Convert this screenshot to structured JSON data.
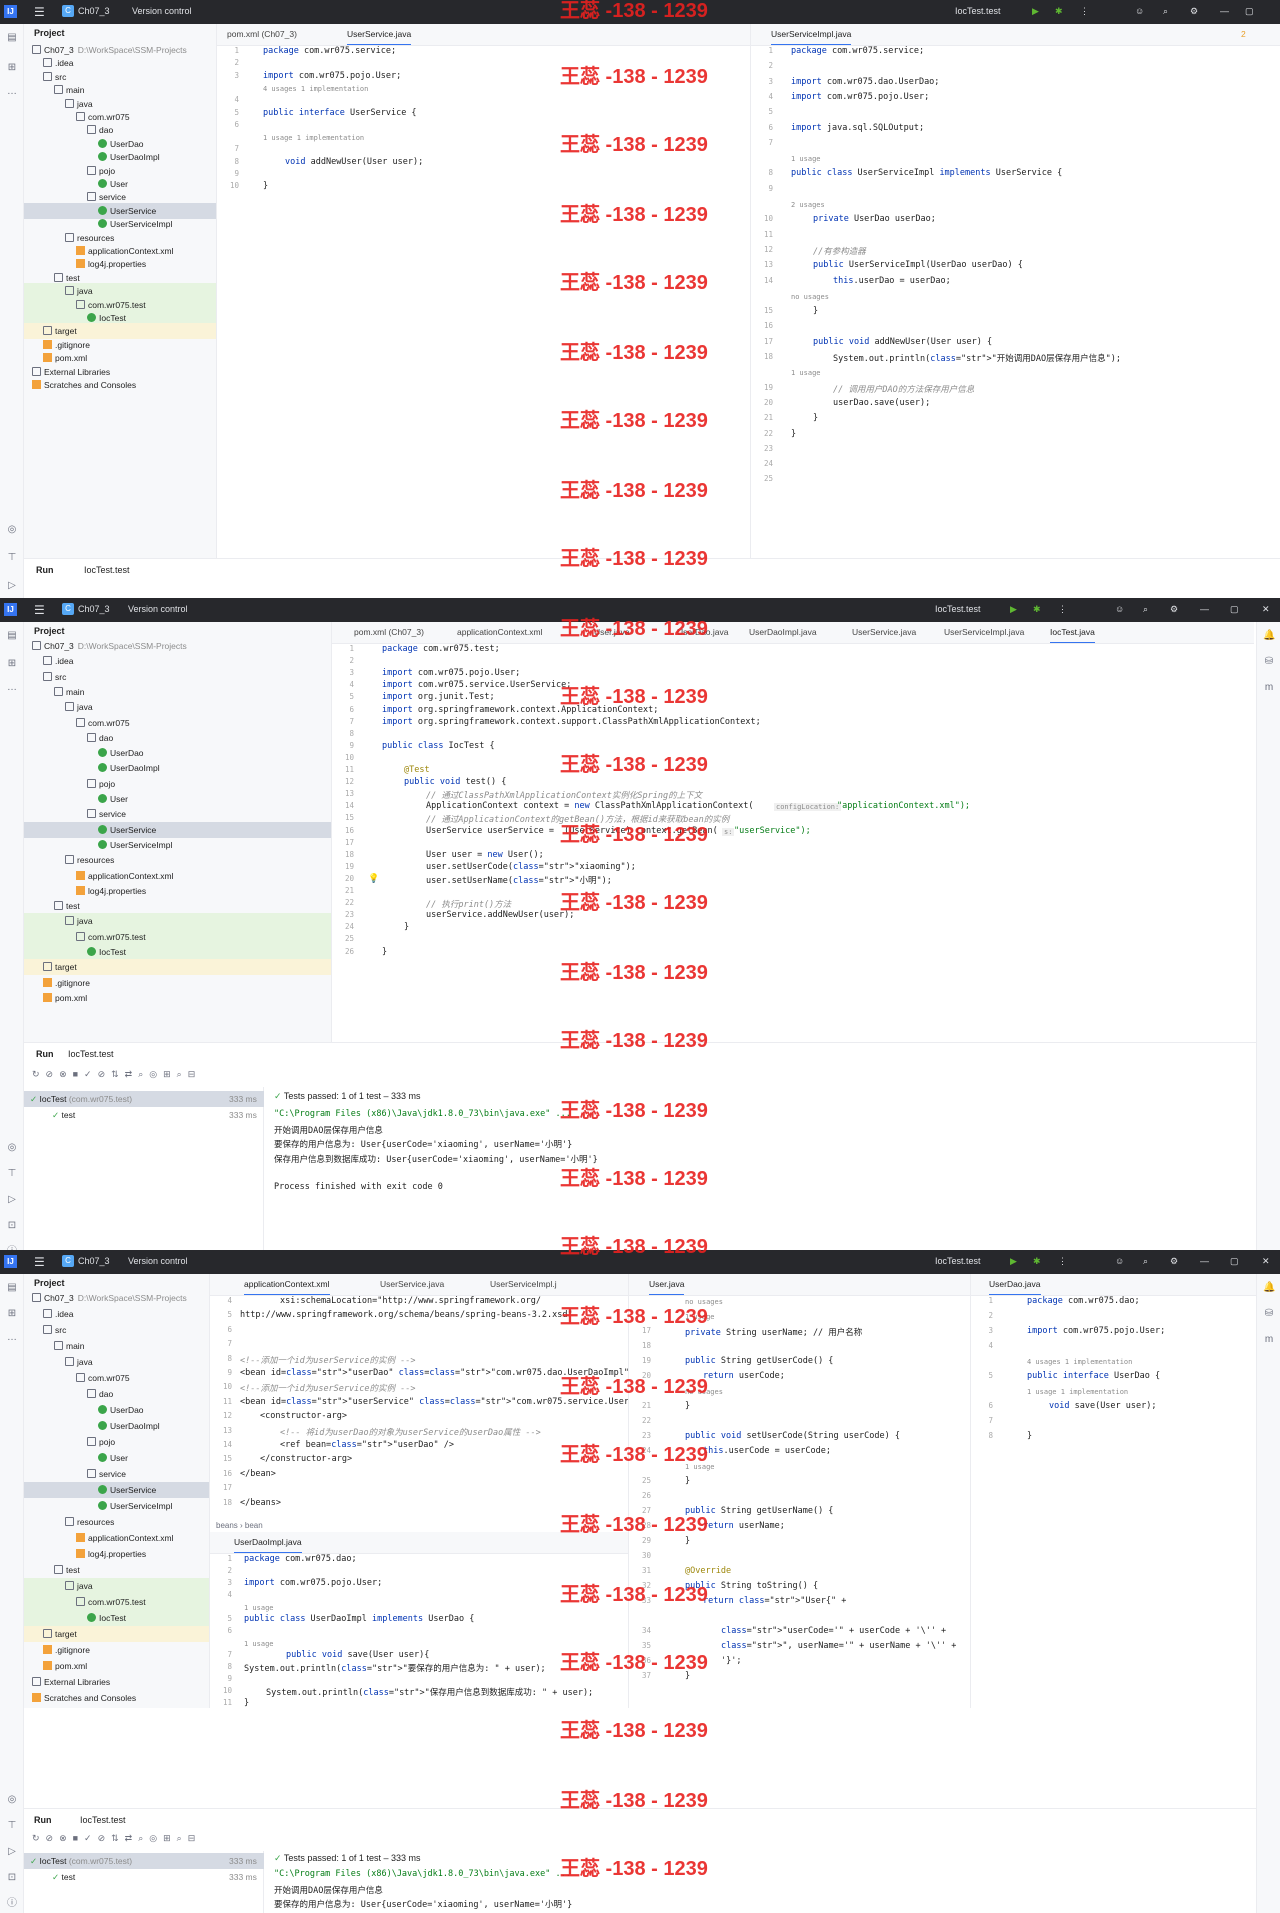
{
  "app": {
    "project": "Ch07_3",
    "vcs": "Version control",
    "run_config": "IocTest.test"
  },
  "watermark": "王蕊 -138 - 1239",
  "p1": {
    "project_label": "Project",
    "root": "Ch07_3",
    "root_path": "D:\\WorkSpace\\SSM-Projects",
    "tree": [
      "Ch07_3",
      ".idea",
      "src",
      "main",
      "java",
      "com.wr075",
      "dao",
      "UserDao",
      "UserDaoImpl",
      "pojo",
      "User",
      "service",
      "UserService",
      "UserServiceImpl",
      "resources",
      "applicationContext.xml",
      "log4j.properties",
      "test",
      "java",
      "com.wr075.test",
      "IocTest",
      "target",
      ".gitignore",
      "pom.xml",
      "External Libraries",
      "Scratches and Consoles"
    ],
    "tabs_left": [
      "pom.xml (Ch07_3)",
      "UserService.java"
    ],
    "tabs_right": [
      "UserServiceImpl.java"
    ],
    "left_lines": [
      "1",
      "2",
      "3",
      "",
      "4",
      "5",
      "6",
      "",
      "7",
      "8",
      "9",
      "10"
    ],
    "left_code": [
      "package com.wr075.service;",
      "",
      "import com.wr075.pojo.User;",
      "",
      "public interface UserService {",
      "",
      "",
      "void addNewUser(User user);",
      "",
      "}"
    ],
    "left_hints": [
      "4 usages   1 implementation",
      "1 usage   1 implementation"
    ],
    "right_lines": [
      "1",
      "2",
      "3",
      "4",
      "5",
      "6",
      "7",
      "",
      "8",
      "9",
      "",
      "10",
      "11",
      "12",
      "13",
      "14",
      "",
      "15",
      "16",
      "17",
      "18",
      "",
      "19",
      "20",
      "21",
      "22",
      "23",
      "24",
      "25"
    ],
    "right_code": [
      "package com.wr075.service;",
      "",
      "import com.wr075.dao.UserDao;",
      "import com.wr075.pojo.User;",
      "",
      "import java.sql.SQLOutput;",
      "",
      "public class UserServiceImpl implements UserService {",
      "",
      "private UserDao userDao;",
      "",
      "//有参构造器",
      "public UserServiceImpl(UserDao userDao) {",
      "this.userDao = userDao;",
      "}",
      "",
      "public void addNewUser(User user) {",
      "System.out.println(\"开始调用DAO层保存用户信息\");",
      "// 调用用户DAO的方法保存用户信息",
      "userDao.save(user);",
      "}",
      "}"
    ],
    "right_hints": [
      "1 usage",
      "2 usages",
      "no usages",
      "1 usage"
    ],
    "warn": "2",
    "run_tab": "Run",
    "run_item": "IocTest.test"
  },
  "p2": {
    "tabs": [
      "pom.xml (Ch07_3)",
      "applicationContext.xml",
      "User.java",
      "UserDao.java",
      "UserDaoImpl.java",
      "UserService.java",
      "UserServiceImpl.java",
      "IocTest.java"
    ],
    "lines": [
      "1",
      "2",
      "3",
      "4",
      "5",
      "6",
      "7",
      "8",
      "9",
      "10",
      "11",
      "12",
      "13",
      "14",
      "15",
      "16",
      "17",
      "18",
      "19",
      "20",
      "21",
      "22",
      "23",
      "24",
      "25",
      "26"
    ],
    "code": [
      "package com.wr075.test;",
      "",
      "import com.wr075.pojo.User;",
      "import com.wr075.service.UserService;",
      "import org.junit.Test;",
      "import org.springframework.context.ApplicationContext;",
      "import org.springframework.context.support.ClassPathXmlApplicationContext;",
      "",
      "public class IocTest {",
      "",
      "@Test",
      "public void test() {",
      "// 通过ClassPathXmlApplicationContext实例化Spring的上下文",
      "ApplicationContext context = new ClassPathXmlApplicationContext(",
      "// 通过ApplicationContext的getBean()方法，根据id来获取bean的实例",
      "UserService userService =  (UserService) context.getBean(",
      "",
      "User user = new User();",
      "user.setUserCode(\"xiaoming\");",
      "user.setUserName(\"小明\");",
      "",
      "// 执行print()方法",
      "userService.addNewUser(user);",
      "}",
      "",
      "}"
    ],
    "param1": "configLocation:",
    "arg1": "\"applicationContext.xml\");",
    "param2": "s:",
    "arg2": "\"userService\");",
    "run_tab": "Run",
    "run_item": "IocTest.test",
    "tests_passed": "Tests passed: 1 of 1 test – 333 ms",
    "test_root": "IocTest",
    "test_root_pkg": "(com.wr075.test)",
    "test_root_time": "333 ms",
    "test_leaf": "test",
    "test_leaf_time": "333 ms",
    "console": [
      "\"C:\\Program Files (x86)\\Java\\jdk1.8.0_73\\bin\\java.exe\" ...",
      "开始调用DAO层保存用户信息",
      "要保存的用户信息为: User{userCode='xiaoming', userName='小明'}",
      "保存用户信息到数据库成功: User{userCode='xiaoming', userName='小明'}",
      "",
      "Process finished with exit code 0"
    ]
  },
  "p3": {
    "tabs_a": [
      "applicationContext.xml",
      "UserService.java",
      "UserServiceImpl.j"
    ],
    "xml_lines": [
      "4",
      "5",
      "6",
      "7",
      "8",
      "9",
      "10",
      "11",
      "12",
      "13",
      "14",
      "15",
      "16",
      "17",
      "18"
    ],
    "xml_code": [
      "xsi:schemaLocation=\"http://www.springframework.org/",
      "http://www.springframework.org/schema/beans/spring-beans-3.2.xsd\"",
      "",
      "",
      "<!--添加一个id为userService的实例 -->",
      "<bean id=\"userDao\" class=\"com.wr075.dao.UserDaoImpl\" />",
      "<!--添加一个id为userService的实例 -->",
      "<bean id=\"userService\" class=\"com.wr075.service.UserServiceImpl\">",
      "<constructor-arg>",
      "<!-- 将id为userDao的对象为userService的userDao属性 -->",
      "<ref bean=\"userDao\" />",
      "</constructor-arg>",
      "</bean>",
      "",
      "</beans>"
    ],
    "crumb": "beans  ›  bean",
    "tab_b": "UserDaoImpl.java",
    "impl_lines": [
      "1",
      "2",
      "3",
      "4",
      "",
      "5",
      "6",
      "",
      "7",
      "8",
      "9",
      "10",
      "11",
      "12",
      "13",
      "14"
    ],
    "impl_code": [
      "package com.wr075.dao;",
      "",
      "import com.wr075.pojo.User;",
      "",
      "public class UserDaoImpl implements UserDao {",
      "",
      "public void save(User user){",
      "System.out.println(\"要保存的用户信息为: \" + user);",
      "",
      "System.out.println(\"保存用户信息到数据库成功: \" + user);",
      "}",
      "",
      "}"
    ],
    "impl_hints": [
      "1 usage",
      "1 usage"
    ],
    "tab_c": "User.java",
    "user_lines": [
      "",
      "",
      "17",
      "18",
      "19",
      "20",
      "",
      "21",
      "22",
      "23",
      "24",
      "",
      "25",
      "26",
      "27",
      "28",
      "29",
      "30",
      "31",
      "32",
      "33",
      "",
      "34",
      "35",
      "36",
      "37"
    ],
    "user_code": [
      "private String userName; // 用户名称",
      "",
      "public String getUserCode() {",
      "return userCode;",
      "}",
      "",
      "public void setUserCode(String userCode) {",
      "this.userCode = userCode;",
      "}",
      "",
      "public String getUserName() {",
      "return userName;",
      "}",
      "",
      "@Override",
      "public String toString() {",
      "return \"User{\" +",
      "\"userCode='\" + userCode + '\\'' +",
      "\", userName='\" + userName + '\\'' +",
      "'}';",
      "}",
      "",
      "public void setUserName(String userName) {",
      "this.userName = userName;",
      "}"
    ],
    "user_hints": [
      "no usages",
      "1 usage",
      "no usages",
      "1 usage"
    ],
    "warn": "3",
    "tab_d": "UserDao.java",
    "dao_lines": [
      "1",
      "2",
      "3",
      "4",
      "",
      "5",
      "",
      "6",
      "7",
      "8"
    ],
    "dao_code": [
      "package com.wr075.dao;",
      "",
      "import com.wr075.pojo.User;",
      "",
      "public interface UserDao {",
      "void save(User user);",
      "",
      "}"
    ],
    "dao_hints": [
      "4 usages   1 implementation",
      "1 usage   1 implementation"
    ],
    "run_tab": "Run",
    "run_item": "IocTest.test",
    "tests_passed": "Tests passed: 1 of 1 test – 333 ms",
    "test_root": "IocTest",
    "test_root_pkg": "(com.wr075.test)",
    "test_root_time": "333 ms",
    "test_leaf": "test",
    "test_leaf_time": "333 ms",
    "console": [
      "\"C:\\Program Files (x86)\\Java\\jdk1.8.0_73\\bin\\java.exe\" ...",
      "开始调用DAO层保存用户信息",
      "要保存的用户信息为: User{userCode='xiaoming', userName='小明'}"
    ]
  }
}
